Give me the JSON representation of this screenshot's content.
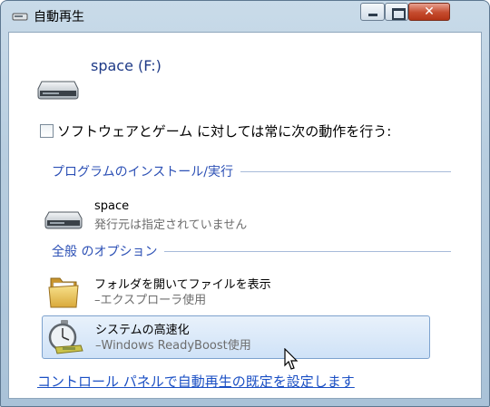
{
  "window": {
    "title": "自動再生",
    "controls": {
      "close_glyph": "✕"
    }
  },
  "drive": {
    "title": "space (F:)",
    "icon": "removable-drive-icon"
  },
  "always_do": {
    "checked": false,
    "label": "ソフトウェアとゲーム に対しては常に次の動作を行う:"
  },
  "sections": {
    "install": {
      "label": "プログラムのインストール/実行"
    },
    "general": {
      "label": "全般 のオプション"
    }
  },
  "items": [
    {
      "line1": "space",
      "line2": "発行元は指定されていません",
      "icon": "drive-icon"
    },
    {
      "line1": "フォルダを開いてファイルを表示",
      "line2": "–エクスプローラ使用",
      "icon": "folder-icon"
    },
    {
      "line1": "システムの高速化",
      "line2": "–Windows ReadyBoost使用",
      "icon": "stopwatch-icon"
    }
  ],
  "footer": {
    "link": "コントロール パネルで自動再生の既定を設定します"
  },
  "colors": {
    "accent": "#2c50b5",
    "link": "#1a4fc4",
    "highlight": "#cfe2f7"
  }
}
